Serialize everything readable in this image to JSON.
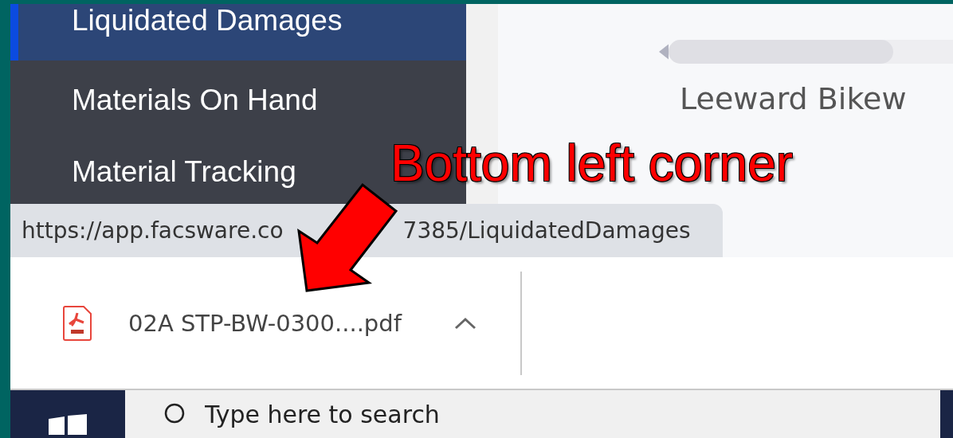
{
  "sidebar": {
    "items": [
      {
        "label": "Liquidated Damages",
        "selected": true
      },
      {
        "label": "Materials On Hand",
        "selected": false
      },
      {
        "label": "Material Tracking",
        "selected": false
      }
    ]
  },
  "main": {
    "project_label": "Leeward Bikew"
  },
  "status_bubble": {
    "url_parts": [
      "https://app.facsware.co",
      "7385/LiquidatedDamages"
    ]
  },
  "download_bar": {
    "items": [
      {
        "file_name": "02A STP-BW-0300....pdf",
        "kind": "pdf"
      }
    ]
  },
  "taskbar": {
    "search": {
      "placeholder": "Type here to search"
    }
  },
  "annotation": {
    "label": "Bottom left corner"
  }
}
